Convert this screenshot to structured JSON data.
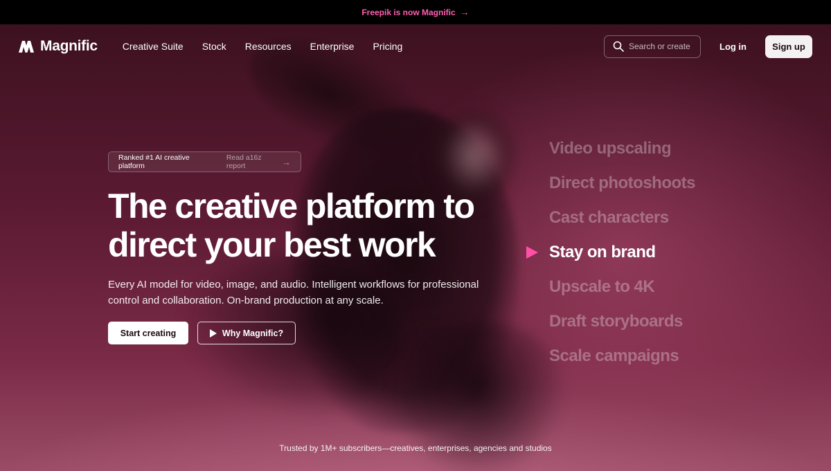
{
  "announcement": {
    "text": "Freepik is now Magnific",
    "arrow": "→"
  },
  "nav": {
    "brand": "Magnific",
    "links": [
      "Creative Suite",
      "Stock",
      "Resources",
      "Enterprise",
      "Pricing"
    ],
    "search_placeholder": "Search or create",
    "login": "Log in",
    "signup": "Sign up"
  },
  "hero": {
    "badge": {
      "rank": "Ranked #1 AI creative platform",
      "link": "Read a16z report",
      "arrow": "→"
    },
    "headline_line1": "The creative platform to",
    "headline_line2": "direct your best work",
    "subtext": "Every AI model for video, image, and audio. Intelligent workflows for professional control and collaboration. On-brand production at any scale.",
    "cta_primary": "Start creating",
    "cta_secondary": "Why Magnific?",
    "features": [
      "Video upscaling",
      "Direct photoshoots",
      "Cast characters",
      "Stay on brand",
      "Upscale to 4K",
      "Draft storyboards",
      "Scale campaigns"
    ],
    "active_feature": "Stay on brand",
    "trusted": "Trusted by 1M+ subscribers—creatives, enterprises, agencies and studios"
  },
  "colors": {
    "accent": "#ff4fa8",
    "announcement_text": "#ff5fb0",
    "background": "#4a1628"
  }
}
